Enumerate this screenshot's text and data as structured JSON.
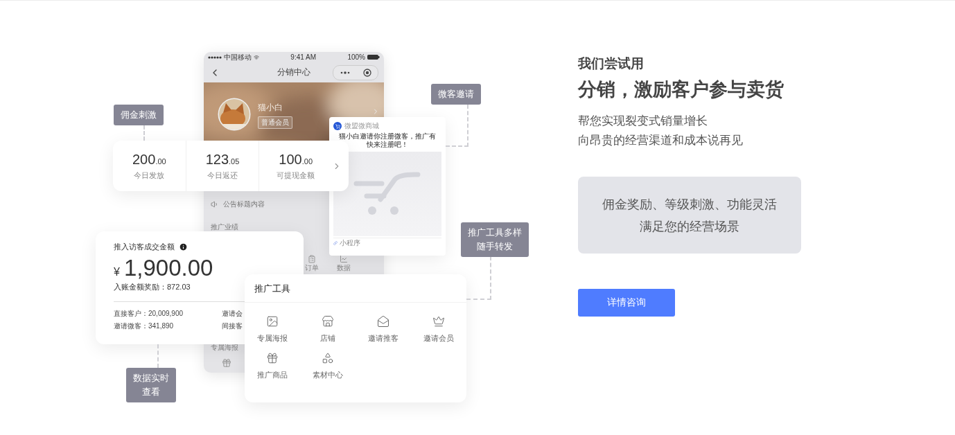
{
  "phone": {
    "status_bar": {
      "carrier": "中国移动",
      "time": "9:41 AM",
      "battery": "100%"
    },
    "title": "分销中心",
    "profile": {
      "name": "猫小白",
      "badge": "普通会员"
    },
    "notice": "公告标题内容",
    "section": "推广业绩",
    "grid_items": [
      {
        "label": "订单"
      },
      {
        "label": "数据"
      }
    ],
    "bottom_label": "专属海报"
  },
  "stats_card": {
    "items": [
      {
        "value": "200",
        "decimals": ".00",
        "label": "今日发放"
      },
      {
        "value": "123",
        "decimals": ".05",
        "label": "今日返还"
      },
      {
        "value": "100",
        "decimals": ".00",
        "label": "可提现金额"
      }
    ]
  },
  "invite_card": {
    "app": "微盟微商城",
    "message_lines": [
      "猫小白邀请你注册微客，推广有",
      "快来注册吧！"
    ],
    "footer": "小程序"
  },
  "earnings_card": {
    "title": "推入访客成交金额",
    "currency": "¥",
    "amount": "1,900.00",
    "reward": "入账金额奖励：872.03",
    "stats": [
      {
        "label": "直接客户：",
        "value": "20,009,900"
      },
      {
        "label": "邀请会"
      },
      {
        "label": "邀请微客：",
        "value": "341,890"
      },
      {
        "label": "间接客"
      }
    ]
  },
  "tools_card": {
    "title": "推广工具",
    "items": [
      {
        "label": "专属海报"
      },
      {
        "label": "店铺"
      },
      {
        "label": "邀请推客"
      },
      {
        "label": "邀请会员"
      },
      {
        "label": "推广商品"
      },
      {
        "label": "素材中心"
      }
    ]
  },
  "callouts": [
    {
      "lines": [
        "佣金刺激"
      ]
    },
    {
      "lines": [
        "微客邀请"
      ]
    },
    {
      "lines": [
        "推广工具多样",
        "随手转发"
      ]
    },
    {
      "lines": [
        "数据实时",
        "查看"
      ]
    }
  ],
  "hero": {
    "eyebrow": "我们尝试用",
    "title": "分销，激励客户参与卖货",
    "subtitle_lines": [
      "帮您实现裂变式销量增长",
      "向昂贵的经营渠道和成本说再见"
    ],
    "feature_lines": [
      "佣金奖励、等级刺激、功能灵活",
      "满足您的经营场景"
    ],
    "button": "详情咨询"
  }
}
